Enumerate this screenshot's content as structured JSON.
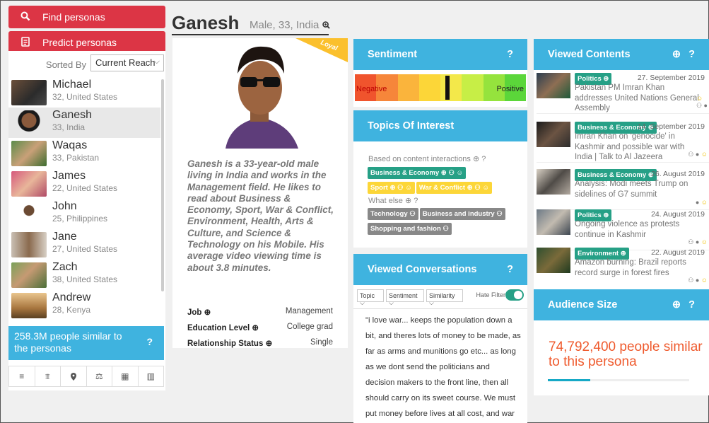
{
  "nav": {
    "find_label": "Find personas",
    "predict_label": "Predict personas"
  },
  "sort": {
    "label": "Sorted By",
    "value": "Current Reach"
  },
  "personas": [
    {
      "name": "Michael",
      "info": "32, United States"
    },
    {
      "name": "Ganesh",
      "info": "33, India"
    },
    {
      "name": "Waqas",
      "info": "33, Pakistan"
    },
    {
      "name": "James",
      "info": "22, United States"
    },
    {
      "name": "John",
      "info": "25, Philippines"
    },
    {
      "name": "Jane",
      "info": "27, United States"
    },
    {
      "name": "Zach",
      "info": "38, United States"
    },
    {
      "name": "Andrew",
      "info": "28, Kenya"
    }
  ],
  "similar": {
    "text": "258.3M people similar to the personas",
    "help": "?"
  },
  "tools": [
    "≡",
    "⩨",
    "⬤",
    "⚖",
    "▦",
    "▥"
  ],
  "profile": {
    "name": "Ganesh",
    "subtitle": "Male, 33, India",
    "badge": "Loyal",
    "bio": "Ganesh is a 33-year-old male living in India and works in the Management field. He likes to read about Business & Economy, Sport, War & Conflict, Environment, Health, Arts & Culture, and Science & Technology on his Mobile. His average video viewing time is about 3.8 minutes.",
    "attributes": [
      {
        "key": "Job",
        "value": "Management"
      },
      {
        "key": "Education Level",
        "value": "College grad"
      },
      {
        "key": "Relationship Status",
        "value": "Single"
      }
    ]
  },
  "sentiment": {
    "title": "Sentiment",
    "help": "?",
    "negative_label": "Negative",
    "positive_label": "Positive",
    "position": 0.54,
    "colors": [
      "#f0542d",
      "#f6863a",
      "#fab43c",
      "#fcd638",
      "#f3e84a",
      "#c7ee46",
      "#95e33d",
      "#5bd63a"
    ]
  },
  "topics": {
    "title": "Topics Of Interest",
    "help": "?",
    "based_label": "Based on content interactions",
    "based_tags": [
      {
        "label": "Business & Economy",
        "color": "green"
      },
      {
        "label": "Sport",
        "color": "yellow"
      },
      {
        "label": "War & Conflict",
        "color": "yellow"
      }
    ],
    "else_label": "What else",
    "else_tags": [
      {
        "label": "Technology",
        "color": "gray"
      },
      {
        "label": "Business and industry",
        "color": "gray"
      },
      {
        "label": "Shopping and fashion",
        "color": "gray"
      }
    ]
  },
  "conversations": {
    "title": "Viewed Conversations",
    "help": "?",
    "filter_topic": "Topic",
    "filter_sentiment": "Sentiment",
    "filter_similarity": "Similarity",
    "hate_filter_label": "Hate Filter",
    "quote": "\"i love war... keeps the population down a bit, and theres lots of money to be made, as far as arms and munitions go etc... as long as we dont send the politicians and decision makers to the front line, then all should carry on its sweet course. We must put money before lives at all cost, and war is great business, long may it continue!\""
  },
  "contents": {
    "title": "Viewed Contents",
    "help": "?",
    "items": [
      {
        "tag": "Politics",
        "date": "27. September 2019",
        "title": "Pakistan PM Imran Khan addresses United Nations General Assembly"
      },
      {
        "tag": "Business & Economy",
        "date": "14. September 2019",
        "title": "Imran Khan on 'genocide' in Kashmir and possible war with India | Talk to Al Jazeera"
      },
      {
        "tag": "Business & Economy",
        "date": "26. August 2019",
        "title": "Analysis: Modi meets Trump on sidelines of G7 summit"
      },
      {
        "tag": "Politics",
        "date": "24. August 2019",
        "title": "Ongoing violence as protests continue in Kashmir"
      },
      {
        "tag": "Environment",
        "date": "22. August 2019",
        "title": "Amazon burning: Brazil reports record surge in forest fires"
      }
    ]
  },
  "audience": {
    "title": "Audience Size",
    "help": "?",
    "text": "74,792,400 people similar to this persona",
    "fill": 0.3
  }
}
